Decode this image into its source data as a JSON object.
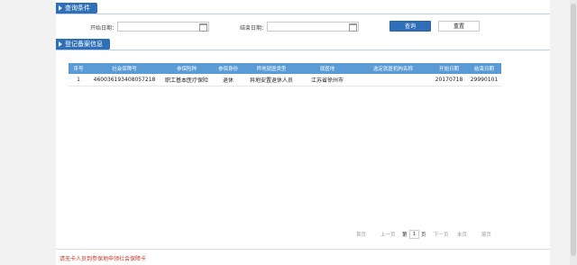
{
  "query_section": {
    "title": "查询条件",
    "start_date_label": "开始日期：",
    "start_date_value": "",
    "end_date_label": "结束日期：",
    "end_date_value": "",
    "search_button": "查询",
    "reset_button": "重置"
  },
  "records_section": {
    "title": "登记备案信息",
    "columns": [
      "序号",
      "社会保障号",
      "参保险种",
      "参保身份",
      "异地就医类型",
      "就医地",
      "选定就医机构名称",
      "开始日期",
      "结束日期"
    ],
    "rows": [
      {
        "index": "1",
        "ssn": "460036193408057218",
        "insurance_type": "职工基本医疗保险",
        "identity": "退休",
        "remote_type": "异地安置退休人员",
        "location": "江苏省徐州市",
        "institution": "",
        "start_date": "20170718",
        "end_date": "29990101"
      }
    ]
  },
  "pager": {
    "first": "首页",
    "prev": "上一页",
    "page_prefix": "第",
    "current_page": "1",
    "page_suffix": "页",
    "next": "下一页",
    "last": "尾页",
    "end": "末页"
  },
  "footer_note": "请无卡人员到参保地申领社会保障卡",
  "colors": {
    "accent": "#2f6fb8",
    "table_header": "#5b9bd5",
    "warning_text": "#c0392b"
  }
}
